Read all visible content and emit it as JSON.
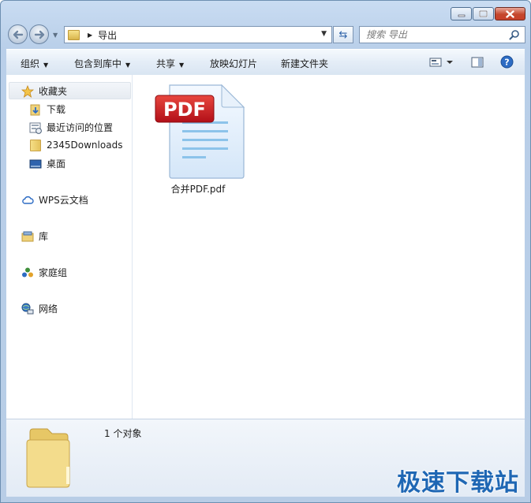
{
  "window": {
    "minimize_label": "",
    "maximize_label": "",
    "close_label": ""
  },
  "address": {
    "current_folder": "导出"
  },
  "search": {
    "placeholder": "搜索 导出"
  },
  "toolbar": {
    "organize": "组织",
    "include_in_library": "包含到库中",
    "share": "共享",
    "slideshow": "放映幻灯片",
    "new_folder": "新建文件夹"
  },
  "sidebar": {
    "favorites": "收藏夹",
    "favorites_items": [
      "下载",
      "最近访问的位置",
      "2345Downloads",
      "桌面"
    ],
    "wps_cloud": "WPS云文档",
    "libraries": "库",
    "homegroup": "家庭组",
    "network": "网络"
  },
  "files": [
    {
      "name": "合并PDF.pdf",
      "badge": "PDF"
    }
  ],
  "details": {
    "item_count": "1 个对象"
  },
  "watermark": "极速下载站",
  "colors": {
    "accent": "#1f67b4",
    "pdf_red": "#c8141c",
    "frame": "#b9cfe9"
  }
}
